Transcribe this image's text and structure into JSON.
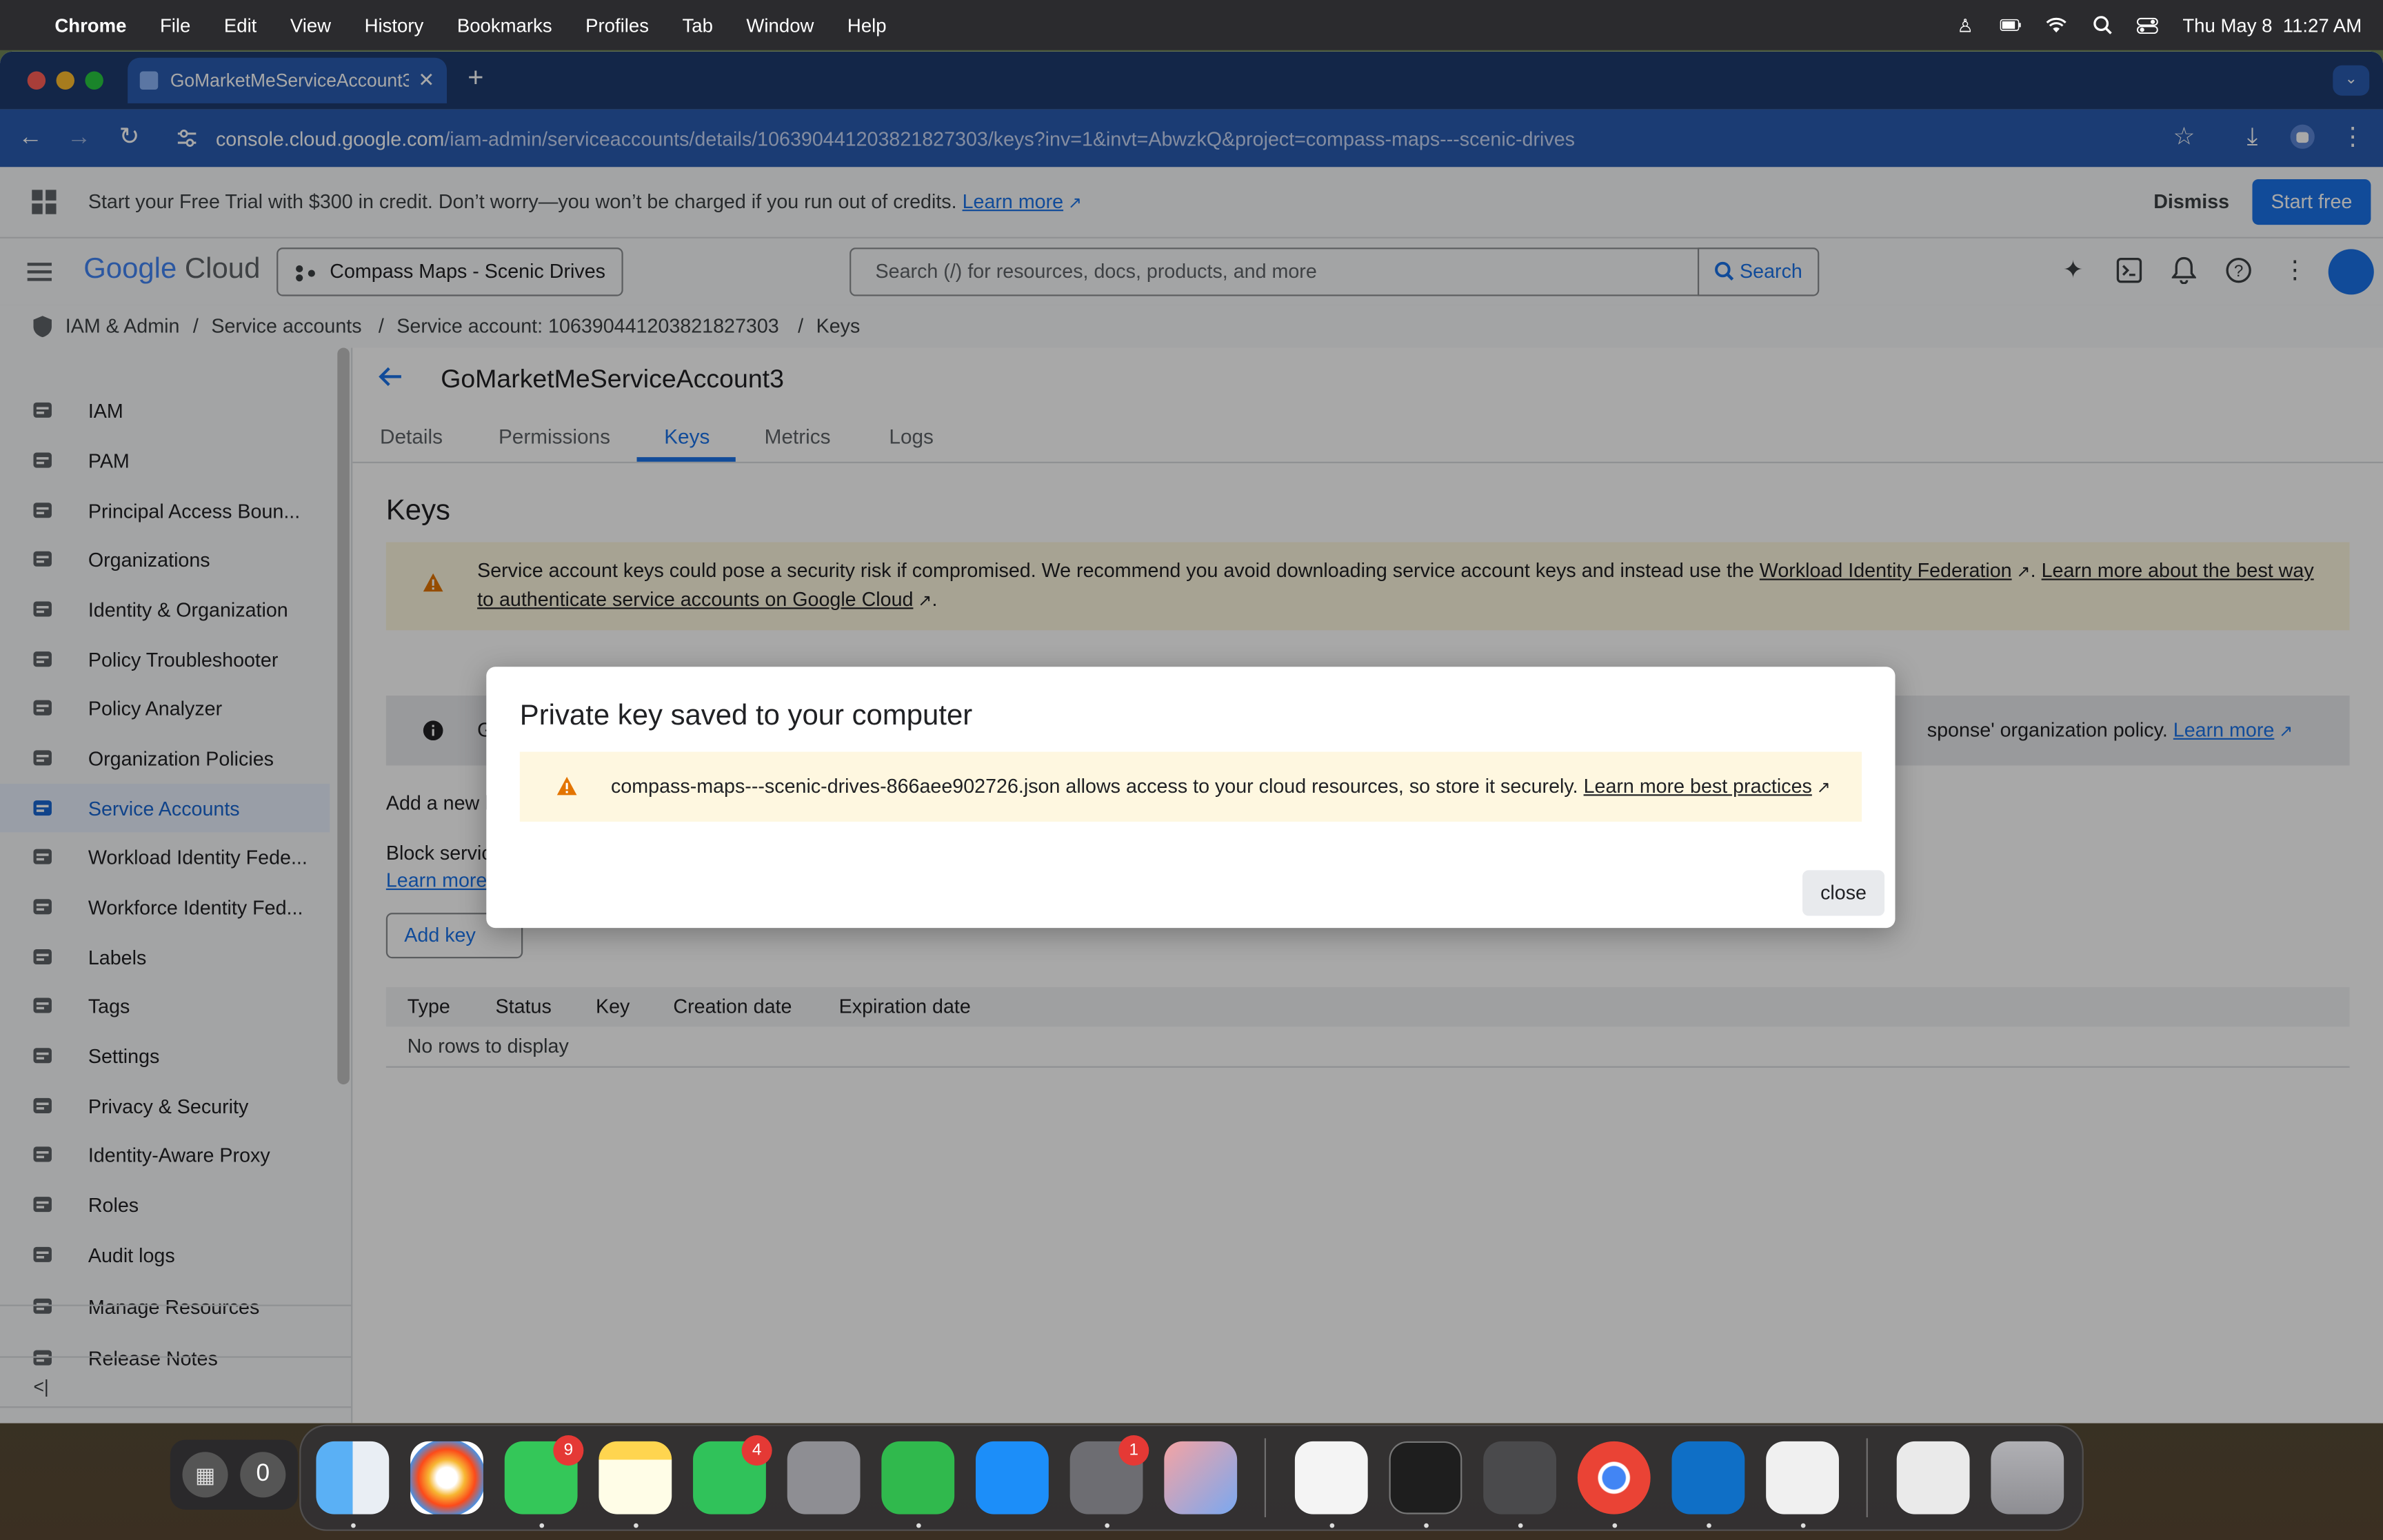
{
  "menubar": {
    "app": "Chrome",
    "items": [
      "File",
      "Edit",
      "View",
      "History",
      "Bookmarks",
      "Profiles",
      "Tab",
      "Window",
      "Help"
    ],
    "clock": "Thu May 8  11:27 AM"
  },
  "browser": {
    "tab_title": "GoMarketMeServiceAccount3",
    "url_domain": "console.cloud.google.com",
    "url_path": "/iam-admin/serviceaccounts/details/106390441203821827303/keys?inv=1&invt=AbwzkQ&project=compass-maps---scenic-drives"
  },
  "trial_banner": {
    "text": "Start your Free Trial with $300 in credit. Don’t worry—you won’t be charged if you run out of credits.",
    "learn_more": "Learn more",
    "dismiss": "Dismiss",
    "start_free": "Start free"
  },
  "header": {
    "logo_google": "Google",
    "logo_cloud": "Cloud",
    "project": "Compass Maps - Scenic Drives",
    "search_placeholder": "Search (/) for resources, docs, products, and more",
    "search_button": "Search"
  },
  "breadcrumb": [
    "IAM & Admin",
    "Service accounts",
    "Service account: 106390441203821827303",
    "Keys"
  ],
  "sidebar": {
    "items": [
      {
        "label": "IAM",
        "icon": "person-add-icon"
      },
      {
        "label": "PAM",
        "icon": "shield-icon"
      },
      {
        "label": "Principal Access Boun...",
        "icon": "policy-icon"
      },
      {
        "label": "Organizations",
        "icon": "building-icon"
      },
      {
        "label": "Identity & Organization",
        "icon": "account-circle-icon"
      },
      {
        "label": "Policy Troubleshooter",
        "icon": "wrench-icon"
      },
      {
        "label": "Policy Analyzer",
        "icon": "analyzer-icon"
      },
      {
        "label": "Organization Policies",
        "icon": "list-box-icon"
      },
      {
        "label": "Service Accounts",
        "icon": "service-account-icon",
        "active": true
      },
      {
        "label": "Workload Identity Fede...",
        "icon": "id-card-icon"
      },
      {
        "label": "Workforce Identity Fed...",
        "icon": "list-icon"
      },
      {
        "label": "Labels",
        "icon": "label-icon"
      },
      {
        "label": "Tags",
        "icon": "tag-icon"
      },
      {
        "label": "Settings",
        "icon": "gear-icon"
      },
      {
        "label": "Privacy & Security",
        "icon": "shield-lock-icon"
      },
      {
        "label": "Identity-Aware Proxy",
        "icon": "proxy-icon"
      },
      {
        "label": "Roles",
        "icon": "roles-icon"
      },
      {
        "label": "Audit logs",
        "icon": "lines-icon"
      },
      {
        "label": "Manage Resources",
        "icon": "resources-icon"
      },
      {
        "label": "Release Notes",
        "icon": "notes-icon"
      }
    ]
  },
  "main": {
    "title": "GoMarketMeServiceAccount3",
    "tabs": [
      {
        "label": "Details"
      },
      {
        "label": "Permissions"
      },
      {
        "label": "Keys",
        "active": true
      },
      {
        "label": "Metrics"
      },
      {
        "label": "Logs"
      }
    ],
    "keys_heading": "Keys",
    "warning_text": "Service account keys could pose a security risk if compromised. We recommend you avoid downloading service account keys and instead use the ",
    "warning_link1": "Workload Identity Federation",
    "warning_link2": "Learn more about the best way to authenticate service accounts on Google Cloud",
    "info_left": "G",
    "info_right": "sponse' organization policy.",
    "info_link": "Learn more",
    "add_new": "Add a new k",
    "block_text": "Block servic",
    "learn_more": "Learn more",
    "add_key": "Add key",
    "table": {
      "columns": [
        "Type",
        "Status",
        "Key",
        "Creation date",
        "Expiration date"
      ],
      "empty": "No rows to display"
    }
  },
  "dialog": {
    "title": "Private key saved to your computer",
    "message": "compass-maps---scenic-drives-866aee902726.json allows access to your cloud resources, so store it securely.",
    "link": "Learn more best practices",
    "close": "close"
  },
  "dock": {
    "counter": "0",
    "badges": {
      "messages": "9",
      "facetime": "4",
      "settings": "1"
    }
  },
  "colors": {
    "accent": "#1a73e8",
    "chrome_tab": "#2a5bb0",
    "warning_bg": "#fef7e0",
    "warning_icon": "#e37400"
  }
}
